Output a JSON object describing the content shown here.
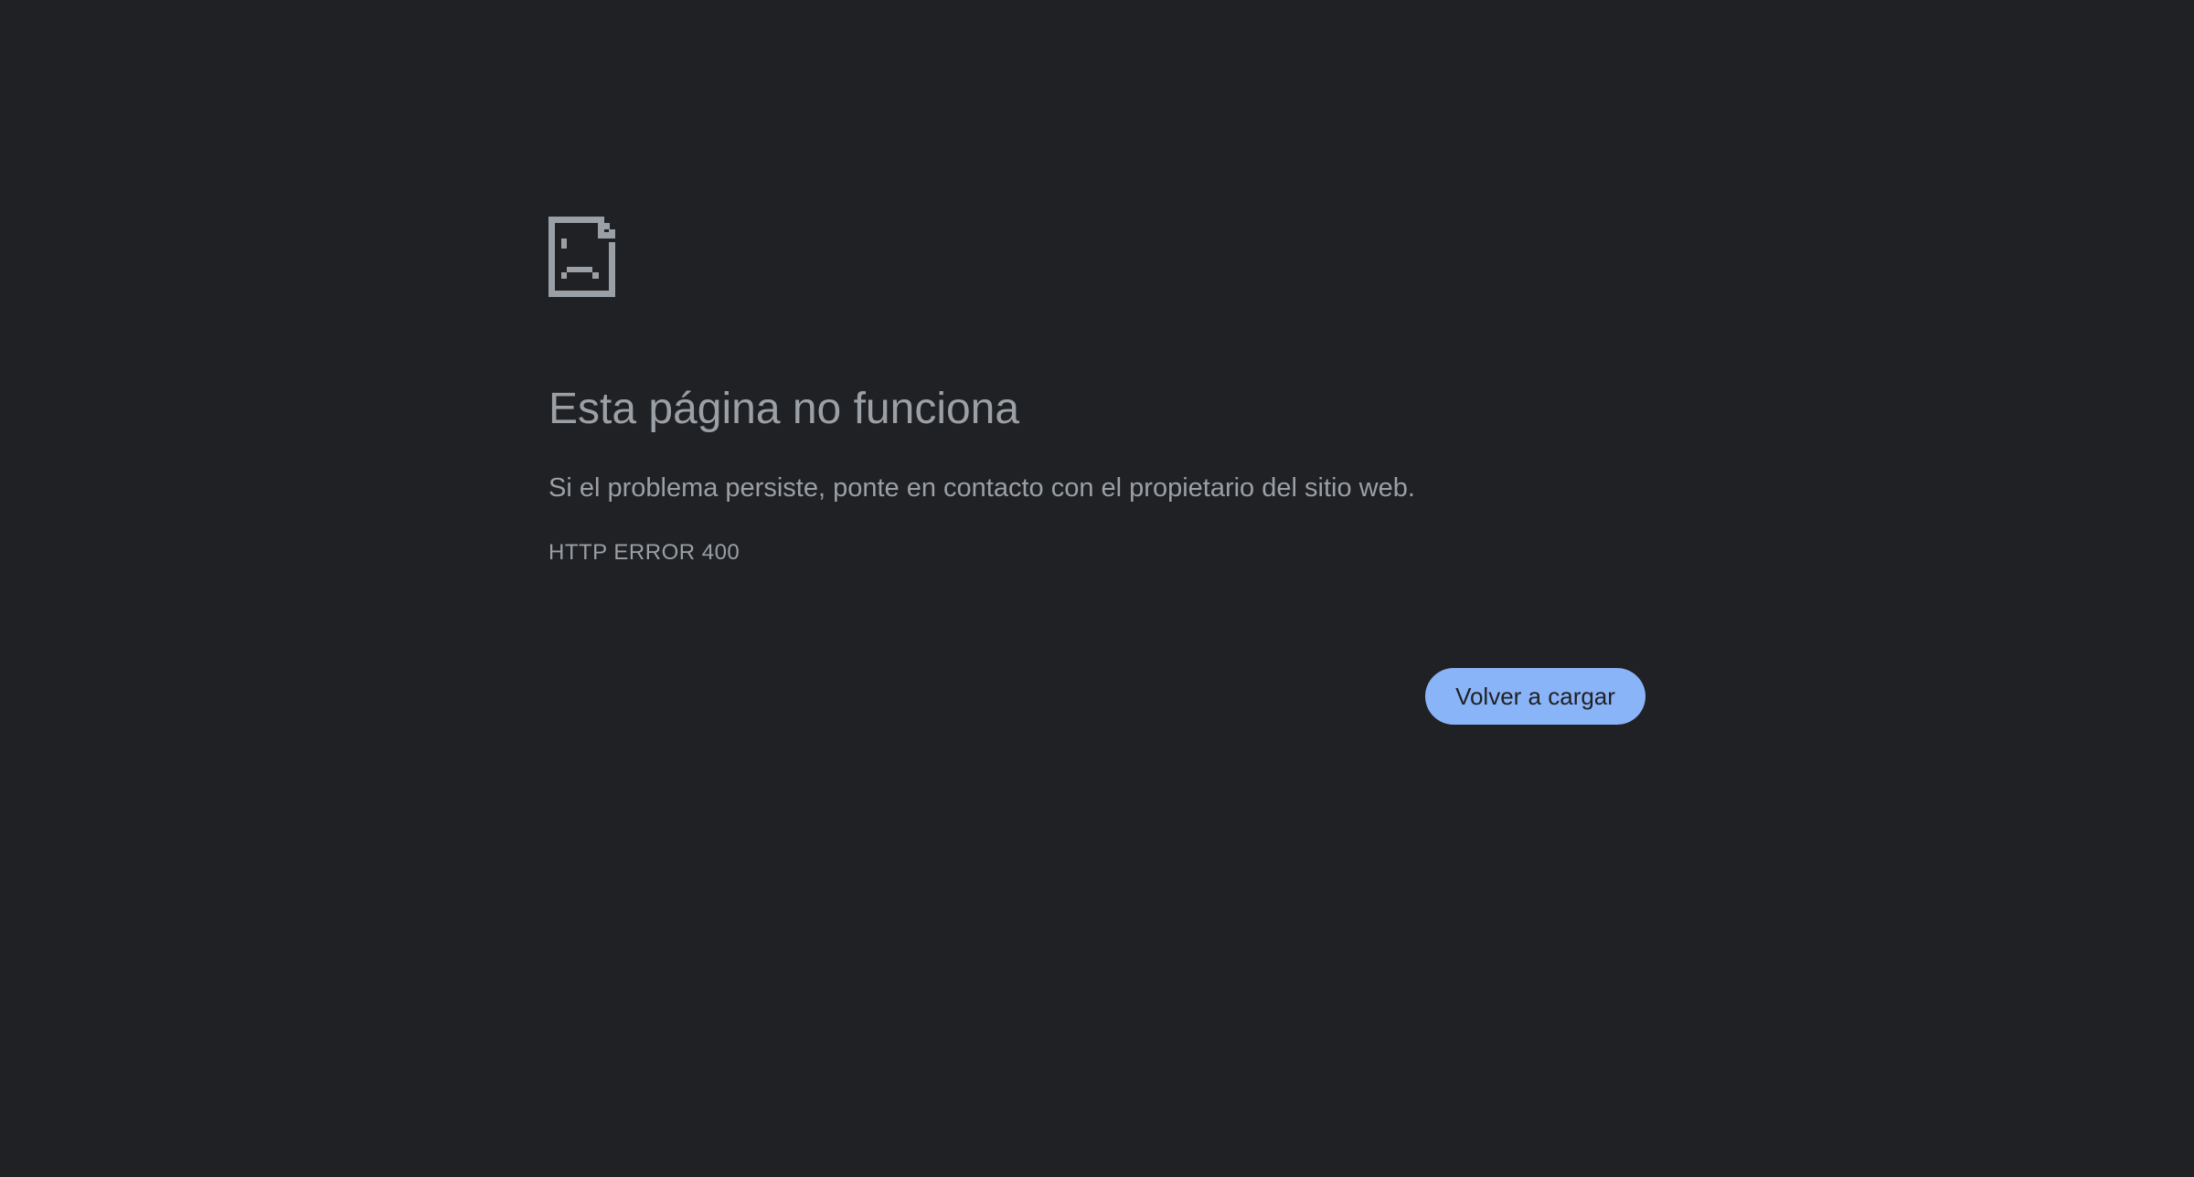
{
  "error_page": {
    "icon": "sad-document-icon",
    "title": "Esta página no funciona",
    "message": "Si el problema persiste, ponte en contacto con el propietario del sitio web.",
    "error_code": "HTTP ERROR 400",
    "reload_label": "Volver a cargar"
  },
  "colors": {
    "background": "#202124",
    "text": "#9aa0a6",
    "button_background": "#8ab4f8",
    "button_text": "#202124"
  }
}
